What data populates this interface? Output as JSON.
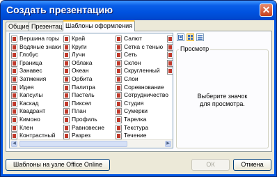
{
  "window": {
    "title": "Создать презентацию"
  },
  "tabs": [
    {
      "label": "Общие",
      "active": false
    },
    {
      "label": "Презентации",
      "active": false
    },
    {
      "label": "Шаблоны оформления",
      "active": true
    }
  ],
  "templates": {
    "columns": [
      [
        "Вершина горы",
        "Водяные знаки",
        "Глобус",
        "Граница",
        "Занавес",
        "Затмения",
        "Идея",
        "Капсулы",
        "Каскад",
        "Квадрант",
        "Кимоно",
        "Клен",
        "Контрастный"
      ],
      [
        "Край",
        "Круги",
        "Лучи",
        "Облака",
        "Океан",
        "Орбита",
        "Палитра",
        "Пастель",
        "Пиксел",
        "План",
        "Профиль",
        "Равновесие",
        "Разрез"
      ],
      [
        "Салют",
        "Сетка с тенью",
        "Сеть",
        "Склон",
        "Скругленный",
        "Слои",
        "Соревнование",
        "Сотрудничество",
        "Студия",
        "Сумерки",
        "Тарелка",
        "Текстура",
        "Течение"
      ],
      [
        "",
        "",
        "",
        "",
        ""
      ]
    ]
  },
  "view_buttons": [
    {
      "icon": "large-icons-view-icon",
      "pressed": false
    },
    {
      "icon": "list-view-icon",
      "pressed": true
    },
    {
      "icon": "details-view-icon",
      "pressed": false
    }
  ],
  "preview": {
    "legend": "Просмотр",
    "text_line1": "Выберите значок",
    "text_line2": "для просмотра."
  },
  "buttons": {
    "online": "Шаблоны на узле Office Online",
    "ok": "ОК",
    "cancel": "Отмена"
  },
  "colors": {
    "title_bar": "#0054e3",
    "active_tab_accent": "#ffc83c",
    "dialog_bg": "#ece9d8"
  }
}
